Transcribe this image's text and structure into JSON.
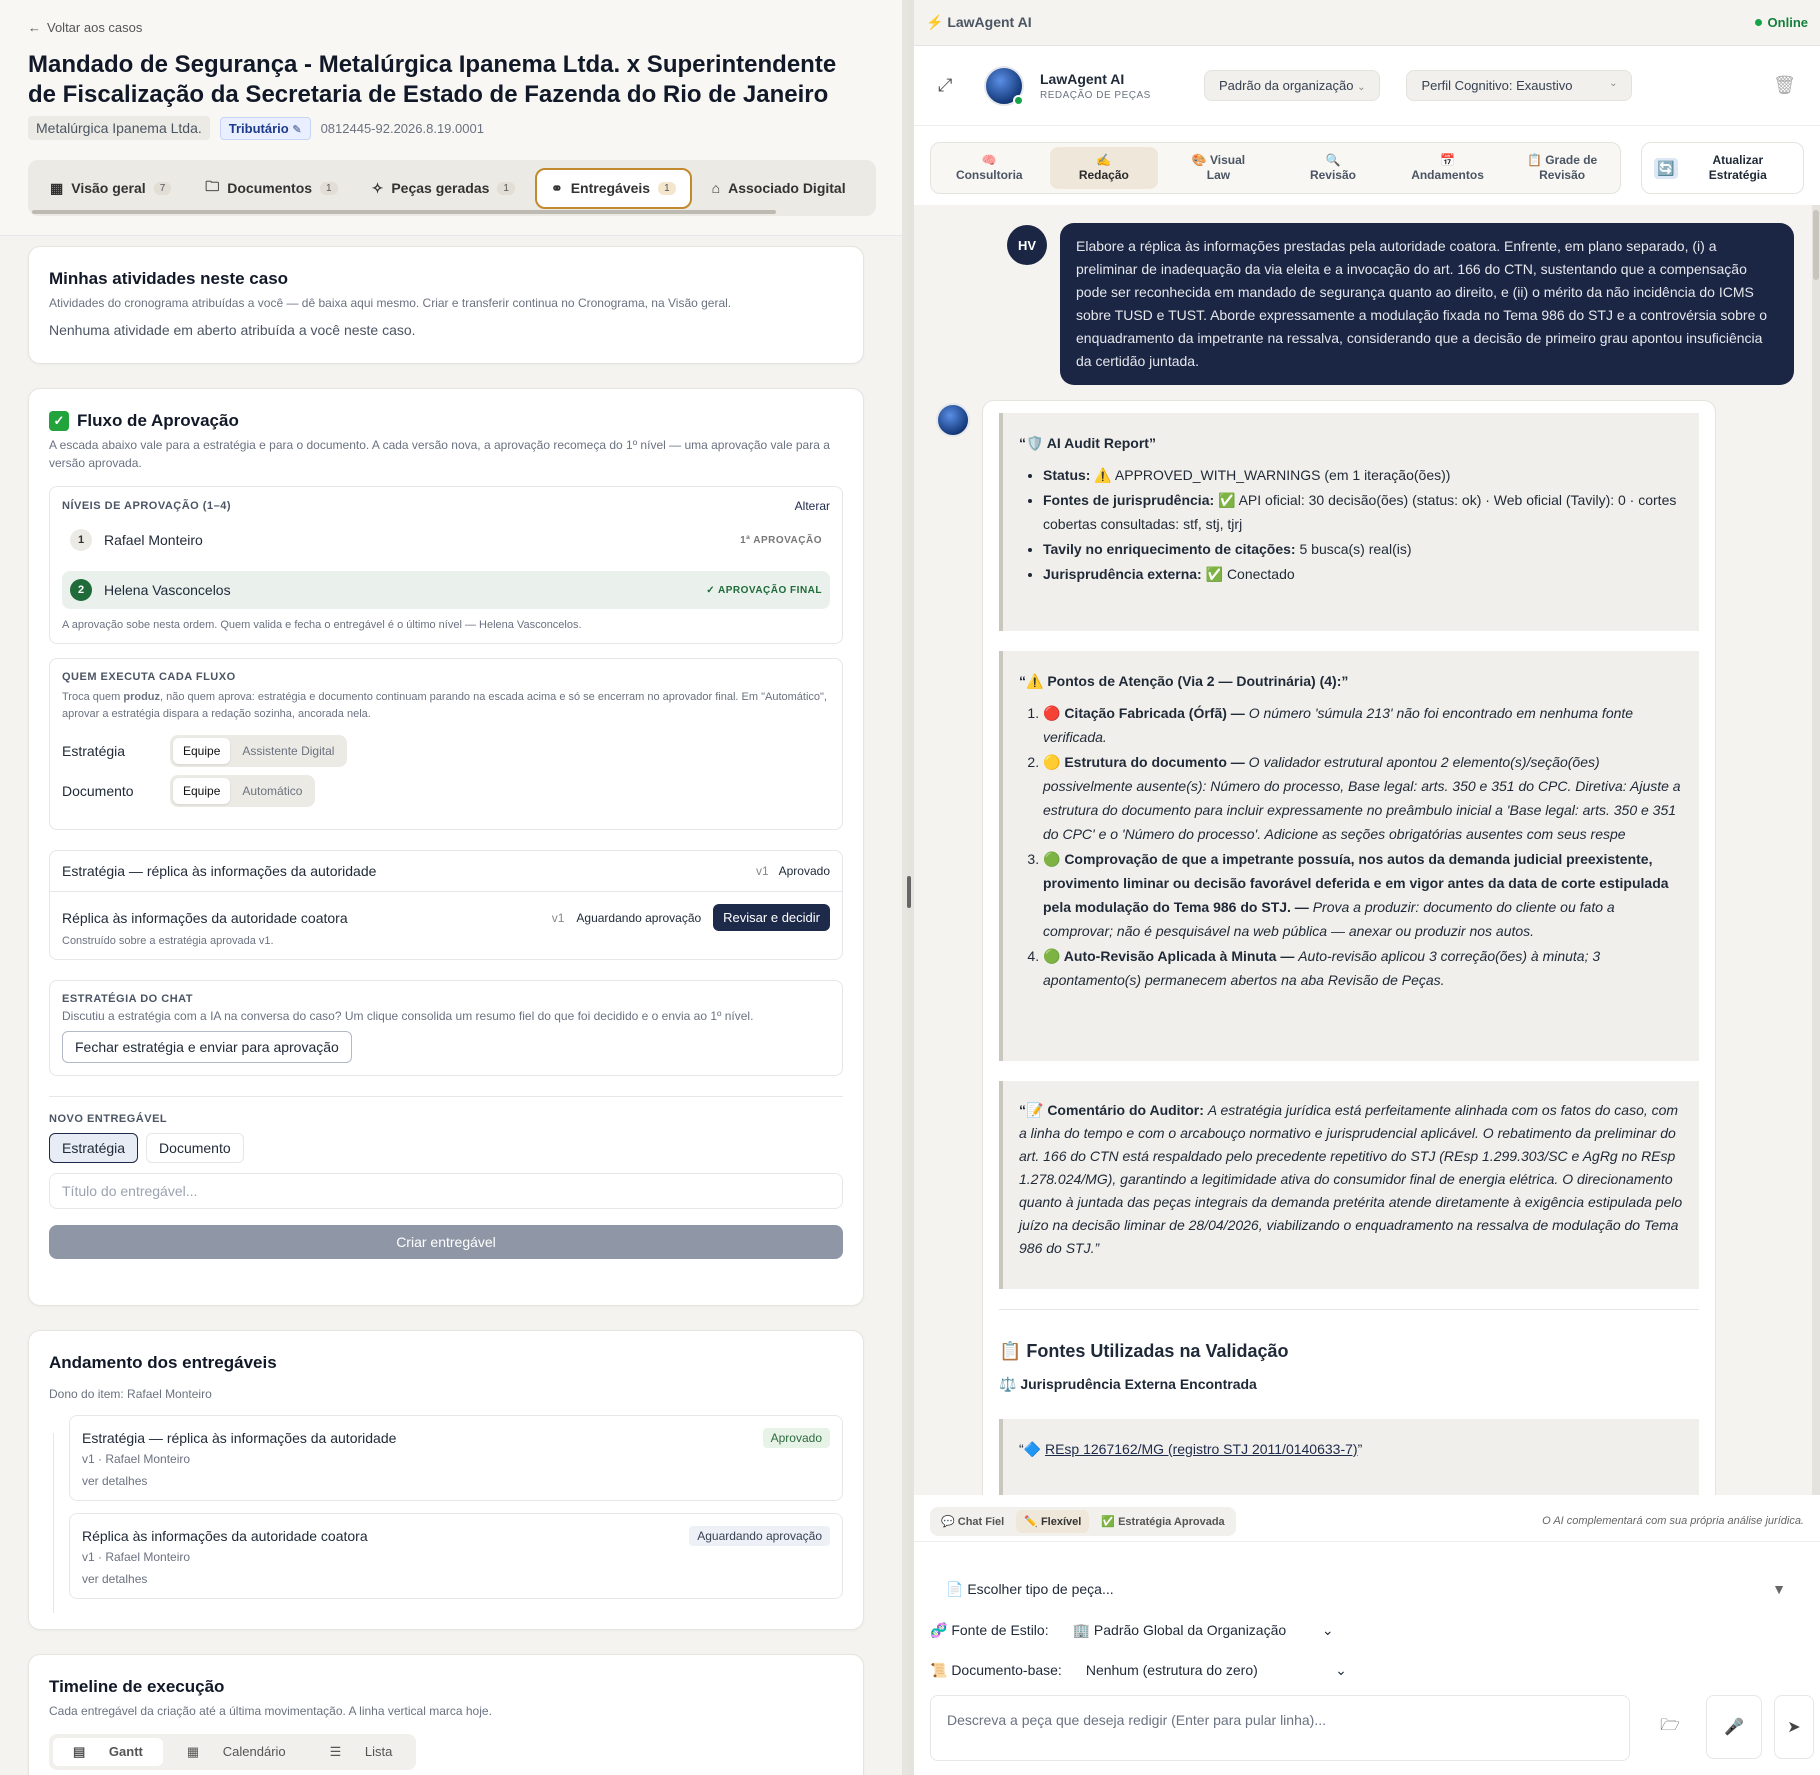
{
  "left": {
    "back": "Voltar aos casos",
    "title": "Mandado de Segurança - Metalúrgica Ipanema Ltda. x Superintendente de Fiscalização da Secretaria de Estado de Fazenda do Rio de Janeiro",
    "client": "Metalúrgica Ipanema Ltda.",
    "area": "Tributário",
    "process": "0812445-92.2026.8.19.0001",
    "tabs": [
      {
        "label": "Visão geral",
        "count": "7"
      },
      {
        "label": "Documentos",
        "count": "1"
      },
      {
        "label": "Peças geradas",
        "count": "1"
      },
      {
        "label": "Entregáveis",
        "count": "1"
      },
      {
        "label": "Associado Digital",
        "count": ""
      }
    ],
    "activities": {
      "title": "Minhas atividades neste caso",
      "sub": "Atividades do cronograma atribuídas a você — dê baixa aqui mesmo. Criar e transferir continua no Cronograma, na Visão geral.",
      "empty": "Nenhuma atividade em aberto atribuída a você neste caso."
    },
    "flow": {
      "title": "Fluxo de Aprovação",
      "sub": "A escada abaixo vale para a estratégia e para o documento. A cada versão nova, a aprovação recomeça do 1º nível — uma aprovação vale para a versão aprovada.",
      "levels_label": "NÍVEIS DE APROVAÇÃO (1–4)",
      "change": "Alterar",
      "levels": [
        {
          "n": "1",
          "name": "Rafael Monteiro",
          "tag": "1ª APROVAÇÃO"
        },
        {
          "n": "2",
          "name": "Helena Vasconcelos",
          "tag": "✓ APROVAÇÃO FINAL"
        }
      ],
      "levels_note": "A aprovação sobe nesta ordem. Quem valida e fecha o entregável é o último nível — Helena Vasconcelos.",
      "exec_label": "QUEM EXECUTA CADA FLUXO",
      "exec_sub_1": "Troca quem ",
      "exec_sub_bold": "produz",
      "exec_sub_2": ", não quem aprova: estratégia e documento continuam parando na escada acima e só se encerram no aprovador final. Em \"Automático\", aprovar a estratégia dispara a redação sozinha, ancorada nela.",
      "strategy_label": "Estratégia",
      "strategy_opts": [
        "Equipe",
        "Assistente Digital"
      ],
      "document_label": "Documento",
      "document_opts": [
        "Equipe",
        "Automático"
      ],
      "item1_title": "Estratégia — réplica às informações da autoridade",
      "item1_ver": "v1",
      "item1_status": "Aprovado",
      "item2_title": "Réplica às informações da autoridade coatora",
      "item2_ver": "v1",
      "item2_status": "Aguardando aprovação",
      "item2_btn": "Revisar e decidir",
      "item2_note": "Construído sobre a estratégia aprovada v1.",
      "chat_label": "ESTRATÉGIA DO CHAT",
      "chat_sub": "Discutiu a estratégia com a IA na conversa do caso? Um clique consolida um resumo fiel do que foi decidido e o envia ao 1º nível.",
      "chat_btn": "Fechar estratégia e enviar para aprovação",
      "new_label": "NOVO ENTREGÁVEL",
      "new_opts": [
        "Estratégia",
        "Documento"
      ],
      "new_placeholder": "Título do entregável...",
      "create_btn": "Criar entregável"
    },
    "progress": {
      "title": "Andamento dos entregáveis",
      "owner": "Dono do item: Rafael Monteiro",
      "items": [
        {
          "title": "Estratégia — réplica às informações da autoridade",
          "meta": "v1 · Rafael Monteiro",
          "link": "ver detalhes",
          "status": "Aprovado"
        },
        {
          "title": "Réplica às informações da autoridade coatora",
          "meta": "v1 · Rafael Monteiro",
          "link": "ver detalhes",
          "status": "Aguardando aprovação"
        }
      ]
    },
    "timeline": {
      "title": "Timeline de execução",
      "sub": "Cada entregável da criação até a última movimentação. A linha vertical marca hoje.",
      "views": [
        "Gantt",
        "Calendário",
        "Lista"
      ]
    }
  },
  "right": {
    "brand": "⚡ LawAgent AI",
    "status": "Online",
    "agent_name": "LawAgent AI",
    "agent_role": "REDAÇÃO DE PEÇAS",
    "org_select": "Padrão da organização",
    "profile_select": "Perfil Cognitivo: Exaustivo",
    "modes": [
      {
        "icon": "🧠",
        "label": "Consultoria"
      },
      {
        "icon": "✍️",
        "label": "Redação"
      },
      {
        "icon": "🎨",
        "label": "Visual Law"
      },
      {
        "icon": "🔍",
        "label": "Revisão"
      },
      {
        "icon": "📅",
        "label": "Andamentos"
      },
      {
        "icon": "📋",
        "label": "Grade de Revisão"
      }
    ],
    "update_btn": "Atualizar Estratégia",
    "user_initials": "HV",
    "user_msg": "Elabore a réplica às informações prestadas pela autoridade coatora. Enfrente, em plano separado, (i) a preliminar de inadequação da via eleita e a invocação do art. 166 do CTN, sustentando que a compensação pode ser reconhecida em mandado de segurança quanto ao direito, e (ii) o mérito da não incidência do ICMS sobre TUSD e TUST. Aborde expressamente a modulação fixada no Tema 986 do STJ e a controvérsia sobre o enquadramento da impetrante na ressalva, considerando que a decisão de primeiro grau apontou insuficiência da certidão juntada.",
    "audit": {
      "title": "“🛡️ AI Audit Report”",
      "items": [
        {
          "k": "Status:",
          "v": " ⚠️ APPROVED_WITH_WARNINGS (em 1 iteração(ões))"
        },
        {
          "k": "Fontes de jurisprudência:",
          "v": " ✅ API oficial: 30 decisão(ões) (status: ok) · Web oficial (Tavily): 0 · cortes cobertas consultadas: stf, stj, tjrj"
        },
        {
          "k": "Tavily no enriquecimento de citações:",
          "v": " 5 busca(s) real(is)"
        },
        {
          "k": "Jurisprudência externa:",
          "v": " ✅ Conectado"
        }
      ]
    },
    "attention": {
      "title": "“⚠️ Pontos de Atenção (Via 2 — Doutrinária) (4):”",
      "items": [
        {
          "k": "🔴 Citação Fabricada (Órfã) — ",
          "v": "O número 'súmula 213' não foi encontrado em nenhuma fonte verificada."
        },
        {
          "k": "🟡 Estrutura do documento — ",
          "v": "O validador estrutural apontou 2 elemento(s)/seção(ões) possivelmente ausente(s): Número do processo, Base legal: arts. 350 e 351 do CPC. Diretiva: Ajuste a estrutura do documento para incluir expressamente no preâmbulo inicial a 'Base legal: arts. 350 e 351 do CPC' e o 'Número do processo'. Adicione as seções obrigatórias ausentes com seus respe"
        },
        {
          "k": "🟢 Comprovação de que a impetrante possuía, nos autos da demanda judicial preexistente, provimento liminar ou decisão favorável deferida e em vigor antes da data de corte estipulada pela modulação do Tema 986 do STJ. — ",
          "v": "Prova a produzir: documento do cliente ou fato a comprovar; não é pesquisável na web pública — anexar ou produzir nos autos."
        },
        {
          "k": "🟢 Auto-Revisão Aplicada à Minuta — ",
          "v": "Auto-revisão aplicou 3 correção(ões) à minuta; 3 apontamento(s) permanecem abertos na aba Revisão de Peças."
        }
      ]
    },
    "comment": {
      "k": "“📝 Comentário do Auditor: ",
      "v": "A estratégia jurídica está perfeitamente alinhada com os fatos do caso, com a linha do tempo e com o arcabouço normativo e jurisprudencial aplicável. O rebatimento da preliminar do art. 166 do CTN está respaldado pelo precedente repetitivo do STJ (REsp 1.299.303/SC e AgRg no REsp 1.278.024/MG), garantindo a legitimidade ativa do consumidor final de energia elétrica. O direcionamento quanto à juntada das peças integrais da demanda pretérita atende diretamente à exigência estipulada pelo juízo na decisão liminar de 28/04/2026, viabilizando o enquadramento na ressalva de modulação do Tema 986 do STJ.”"
    },
    "sources_title": "📋 Fontes Utilizadas na Validação",
    "sources_sub": "⚖️ Jurisprudência Externa Encontrada",
    "source1_pre": "“🔷 ",
    "source1": "REsp 1267162/MG (registro STJ 2011/0140633-7)",
    "source1_post": "”",
    "chips": [
      "💬 Chat Fiel",
      "✏️ Flexível",
      "✅ Estratégia Aprovada"
    ],
    "chips_note": "O AI complementará com sua própria análise jurídica.",
    "piece_select": "📄 Escolher tipo de peça...",
    "style_label": "🧬 Fonte de Estilo:",
    "style_value": "🏢 Padrão Global da Organização",
    "base_label": "📜 Documento-base:",
    "base_value": "Nenhum (estrutura do zero)",
    "composer_placeholder": "Descreva a peça que deseja redigir (Enter para pular linha)..."
  }
}
